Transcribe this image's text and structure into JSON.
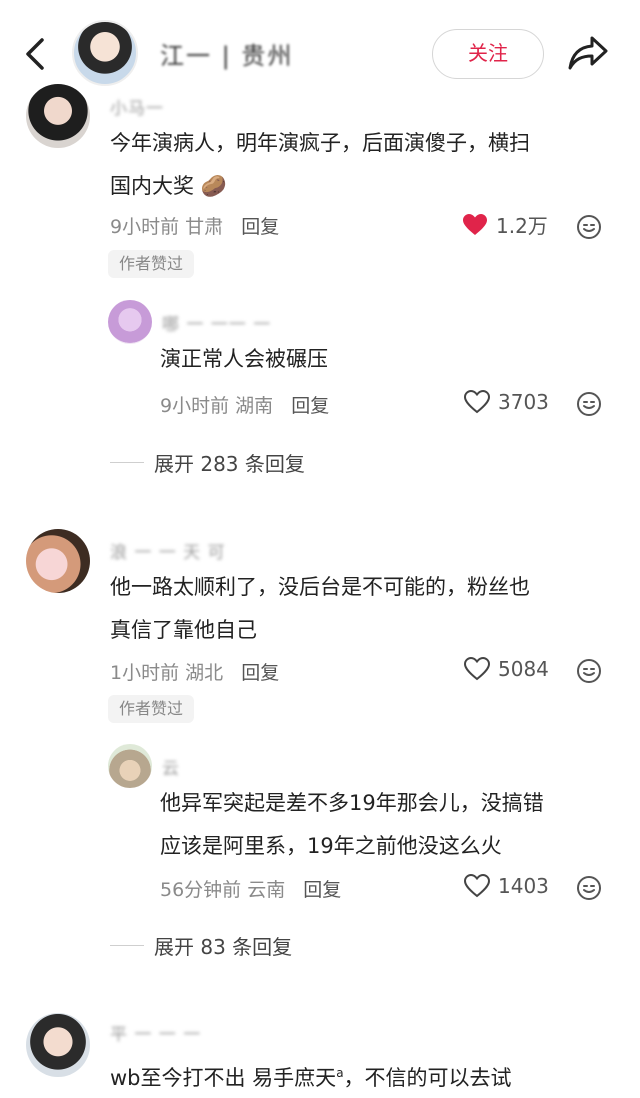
{
  "header": {
    "username": "江一 | 贵州",
    "follow_label": "关注"
  },
  "comments": [
    {
      "username": "小马一",
      "text_line1": "今年演病人，明年演疯子，后面演傻子，横扫",
      "text_line2": "国内大奖",
      "emoji": "🥔",
      "time": "9小时前",
      "location": "甘肃",
      "reply_label": "回复",
      "likes": "1.2万",
      "liked": true,
      "badge": "作者赞过",
      "sub_reply": {
        "username": "哪 一 一一 一 ",
        "text": "演正常人会被碾压",
        "time": "9小时前",
        "location": "湖南",
        "reply_label": "回复",
        "likes": "3703"
      },
      "expand_label": "展开 283 条回复"
    },
    {
      "username": "浪 一 一 天 可",
      "text_line1": "他一路太顺利了，没后台是不可能的，粉丝也",
      "text_line2": "真信了靠他自己",
      "time": "1小时前",
      "location": "湖北",
      "reply_label": "回复",
      "likes": "5084",
      "badge": "作者赞过",
      "sub_reply": {
        "username": "云",
        "text_line1": "他异军突起是差不多19年那会儿，没搞错",
        "text_line2": "应该是阿里系，19年之前他没这么火",
        "time": "56分钟前",
        "location": "云南",
        "reply_label": "回复",
        "likes": "1403"
      },
      "expand_label": "展开 83 条回复"
    },
    {
      "username": "平 一 一 一",
      "text_line1": "wb至今打不出 易手庶天",
      "text_suffix": "，不信的可以去试"
    }
  ],
  "colors": {
    "accent_red": "#e0244a",
    "meta_gray": "#8a8a8a"
  }
}
